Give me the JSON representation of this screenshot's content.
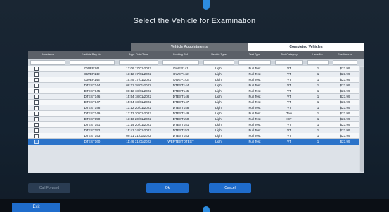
{
  "dialog": {
    "title": "Select the Vehicle for Examination"
  },
  "tabs": [
    {
      "label": "Vehicle Appointments"
    },
    {
      "label": "Completed Vehicles"
    }
  ],
  "table": {
    "columns": [
      "Assistance",
      "Vehicle Reg No.",
      "Appt. Date/Time",
      "Booking Ref.",
      "Vehicle Type",
      "Test Type",
      "Test Category",
      "Lane No.",
      "Fee Amount"
    ],
    "selected_row": 14,
    "rows": [
      [
        "DWEP141",
        "13:06 17/01/2022",
        "DWEP141",
        "Light",
        "Full Test",
        "VT",
        "1",
        "$23.99"
      ],
      [
        "DWEP142",
        "13:12 17/01/2022",
        "DWEP142",
        "Light",
        "Full Test",
        "VT",
        "1",
        "$23.99"
      ],
      [
        "DWEP143",
        "15:45 17/01/2022",
        "DWEP143",
        "Light",
        "Full Test",
        "VT",
        "1",
        "$23.99"
      ],
      [
        "DTEST144",
        "08:11 18/01/2022",
        "DTEST144",
        "Light",
        "Full Test",
        "VT",
        "1",
        "$23.99"
      ],
      [
        "DTEST145",
        "08:12 18/01/2022",
        "DTEST145",
        "Light",
        "Full Test",
        "VT",
        "1",
        "$23.99"
      ],
      [
        "DTEST146",
        "15:54 18/01/2022",
        "DTEST146",
        "Light",
        "Full Test",
        "VT",
        "1",
        "$23.99"
      ],
      [
        "DTEST147",
        "15:54 18/01/2022",
        "DTEST147",
        "Light",
        "Full Test",
        "VT",
        "1",
        "$23.99"
      ],
      [
        "DTEST148",
        "13:12 20/01/2022",
        "DTEST148",
        "Light",
        "Full Test",
        "VT",
        "1",
        "$23.99"
      ],
      [
        "DTEST149",
        "13:13 20/01/2022",
        "DTEST149",
        "Light",
        "Full Test",
        "Taxi",
        "1",
        "$23.99"
      ],
      [
        "DTEST150",
        "13:13 20/01/2022",
        "DTEST150",
        "Light",
        "Full Test",
        "IBT",
        "1",
        "$23.99"
      ],
      [
        "DTEST151",
        "13:14 20/01/2022",
        "DTEST151",
        "Light",
        "Full Test",
        "VT",
        "1",
        "$23.99"
      ],
      [
        "DTEST152",
        "15:41 24/01/2022",
        "DTEST152",
        "Light",
        "Full Test",
        "VT",
        "1",
        "$23.99"
      ],
      [
        "DTEST153",
        "09:11 31/01/2022",
        "DTEST153",
        "Light",
        "Full Test",
        "VT",
        "1",
        "$23.99"
      ],
      [
        "DTEST160",
        "11:46 31/01/2022",
        "WEPTESTDTEST",
        "Light",
        "Full Test",
        "VT",
        "1",
        "$23.99"
      ]
    ]
  },
  "buttons": {
    "call_forward": "Call Forward",
    "ok": "Ok",
    "cancel": "Cancel",
    "exit": "Exit"
  },
  "colors": {
    "accent": "#1f6ccb",
    "selected_row": "#2b73c9",
    "header": "#5b6068",
    "background": "#142230"
  }
}
